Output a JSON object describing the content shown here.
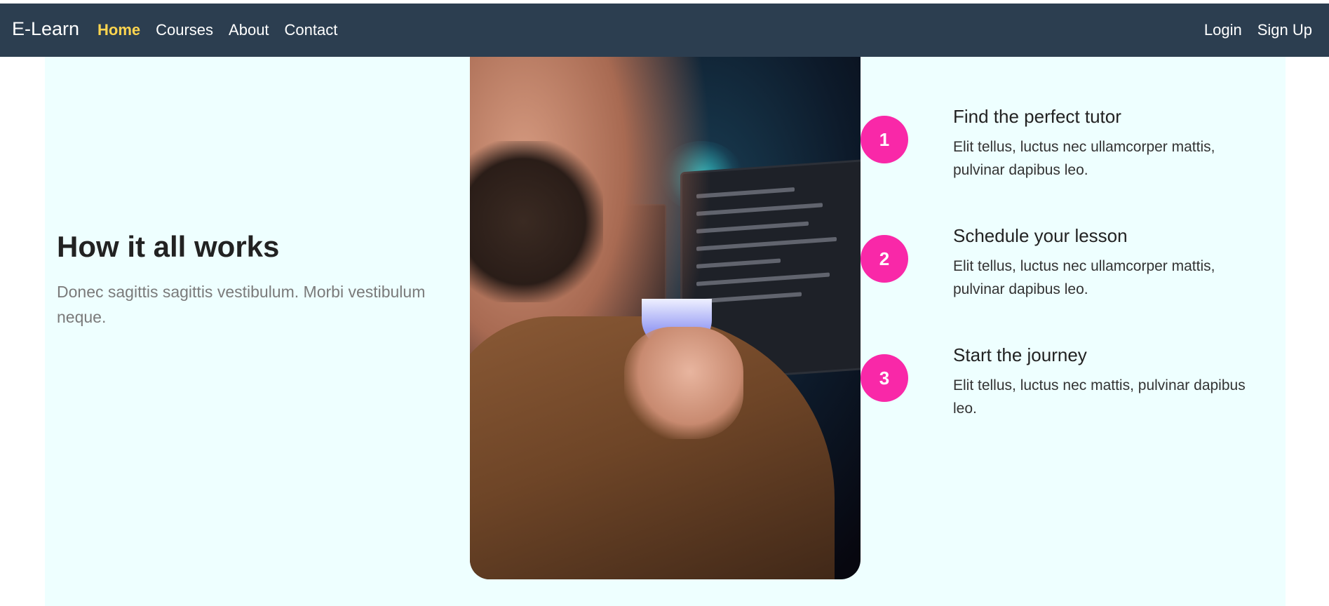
{
  "nav": {
    "brand": "E-Learn",
    "links": [
      "Home",
      "Courses",
      "About",
      "Contact"
    ],
    "active": "Home",
    "auth": [
      "Login",
      "Sign Up"
    ]
  },
  "hero": {
    "heading": "How it all works",
    "lead": "Donec sagittis sagittis vestibulum. Morbi vestibulum neque."
  },
  "steps": [
    {
      "number": "1",
      "title": "Find the perfect tutor",
      "desc": "Elit tellus, luctus nec ullamcorper mattis, pulvinar dapibus leo."
    },
    {
      "number": "2",
      "title": "Schedule your lesson",
      "desc": "Elit tellus, luctus nec ullamcorper mattis, pulvinar dapibus leo."
    },
    {
      "number": "3",
      "title": "Start the journey",
      "desc": "Elit tellus, luctus nec mattis, pulvinar dapibus leo."
    }
  ],
  "colors": {
    "navbar": "#2c3e50",
    "active_link": "#ffd54f",
    "section_bg": "#eeffff",
    "step_badge": "#f928a8"
  }
}
